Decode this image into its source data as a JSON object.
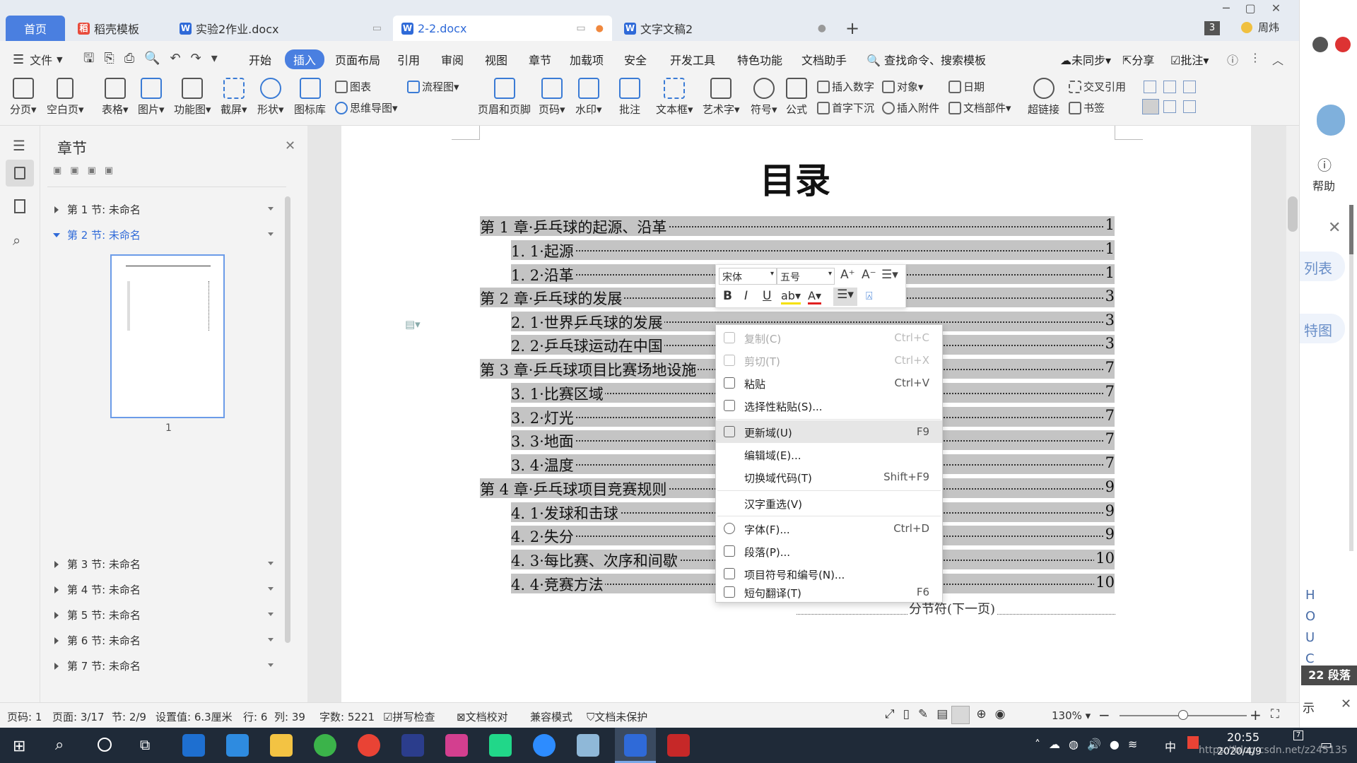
{
  "tabs": {
    "home": "首页",
    "items": [
      {
        "label": "稻壳模板"
      },
      {
        "label": "实验2作业.docx"
      },
      {
        "label": "2-2.docx"
      },
      {
        "label": "文字文稿2"
      }
    ],
    "counter": "3",
    "user": "周炜",
    "new_tab": "+"
  },
  "menu": {
    "file": "文件",
    "items": [
      "开始",
      "插入",
      "页面布局",
      "引用",
      "审阅",
      "视图",
      "章节",
      "加载项",
      "安全",
      "开发工具",
      "特色功能",
      "文档助手"
    ],
    "search": "查找命令、搜索模板",
    "sync": "未同步",
    "share": "分享",
    "comment": "批注"
  },
  "ribbon": {
    "page_break": "分页",
    "blank_page": "空白页",
    "table": "表格",
    "picture": "图片",
    "function_chart": "功能图",
    "screenshot": "截屏",
    "shape": "形状",
    "icon_lib": "图标库",
    "chart": "图表",
    "mindmap": "思维导图",
    "flowchart": "流程图",
    "header_footer": "页眉和页脚",
    "page_number": "页码",
    "watermark": "水印",
    "annotation": "批注",
    "textbox": "文本框",
    "wordart": "艺术字",
    "symbol": "符号",
    "formula": "公式",
    "insert_number": "插入数字",
    "object": "对象",
    "date": "日期",
    "drop_cap": "首字下沉",
    "attachment": "插入附件",
    "doc_parts": "文档部件",
    "hyperlink": "超链接",
    "cross_ref": "交叉引用",
    "bookmark": "书签"
  },
  "panel": {
    "title": "章节",
    "sections": [
      {
        "label": "第 1 节: 未命名"
      },
      {
        "label": "第 2 节: 未命名"
      },
      {
        "label": "第 3 节: 未命名"
      },
      {
        "label": "第 4 节: 未命名"
      },
      {
        "label": "第 5 节: 未命名"
      },
      {
        "label": "第 6 节: 未命名"
      },
      {
        "label": "第 7 节: 未命名"
      }
    ],
    "thumb_page": "1"
  },
  "document": {
    "title": "目录",
    "toc": [
      {
        "text": "第 1 章·乒乓球的起源、沿革",
        "page": "1"
      },
      {
        "text": "1. 1·起源",
        "page": "1"
      },
      {
        "text": "1. 2·沿革",
        "page": "1"
      },
      {
        "text": "第 2 章·乒乓球的发展",
        "page": "3"
      },
      {
        "text": "2. 1·世界乒乓球的发展",
        "page": "3"
      },
      {
        "text": "2. 2·乒乓球运动在中国",
        "page": "3"
      },
      {
        "text": "第 3 章·乒乓球项目比赛场地设施",
        "page": "7"
      },
      {
        "text": "3. 1·比赛区域",
        "page": "7"
      },
      {
        "text": "3. 2·灯光",
        "page": "7"
      },
      {
        "text": "3. 3·地面",
        "page": "7"
      },
      {
        "text": "3. 4·温度",
        "page": "7"
      },
      {
        "text": "第 4 章·乒乓球项目竞赛规则",
        "page": "9"
      },
      {
        "text": "4. 1·发球和击球",
        "page": "9"
      },
      {
        "text": "4. 2·失分",
        "page": "9"
      },
      {
        "text": "4. 3·每比赛、次序和间歇",
        "page": "10"
      },
      {
        "text": "4. 4·竞赛方法",
        "page": "10"
      }
    ],
    "section_break": "分节符(下一页)"
  },
  "float_toolbar": {
    "font": "宋体",
    "size": "五号"
  },
  "context_menu": {
    "items": [
      {
        "label": "复制(C)",
        "shortcut": "Ctrl+C"
      },
      {
        "label": "剪切(T)",
        "shortcut": "Ctrl+X"
      },
      {
        "label": "粘贴",
        "shortcut": "Ctrl+V"
      },
      {
        "label": "选择性粘贴(S)...",
        "shortcut": ""
      },
      {
        "label": "更新域(U)",
        "shortcut": "F9"
      },
      {
        "label": "编辑域(E)...",
        "shortcut": ""
      },
      {
        "label": "切换域代码(T)",
        "shortcut": "Shift+F9"
      },
      {
        "label": "汉字重选(V)",
        "shortcut": ""
      },
      {
        "label": "字体(F)...",
        "shortcut": "Ctrl+D"
      },
      {
        "label": "段落(P)...",
        "shortcut": ""
      },
      {
        "label": "项目符号和编号(N)...",
        "shortcut": ""
      },
      {
        "label": "短句翻译(T)",
        "shortcut": "F6"
      }
    ]
  },
  "status": {
    "page_no": "页码: 1",
    "page": "页面: 3/17",
    "section": "节: 2/9",
    "setting": "设置值: 6.3厘米",
    "row": "行: 6",
    "col": "列: 39",
    "words": "字数: 5221",
    "spell": "拼写检查",
    "proof": "文档校对",
    "compat": "兼容模式",
    "protect": "文档未保护",
    "zoom": "130%"
  },
  "right_panel": {
    "help": "帮助",
    "list": "列表",
    "pic": "特图",
    "letters": [
      "H",
      "O",
      "U",
      "C"
    ],
    "para": "22 段落",
    "show": "示"
  },
  "taskbar": {
    "time": "20:55",
    "date": "2020/4/9",
    "ime": "中",
    "notify_count": "7",
    "watermark": "https://blog.csdn.net/z245135"
  },
  "colors": {
    "accent": "#4a7fe0",
    "selection": "#c4c4c4",
    "taskbar": "#1f2a38"
  }
}
